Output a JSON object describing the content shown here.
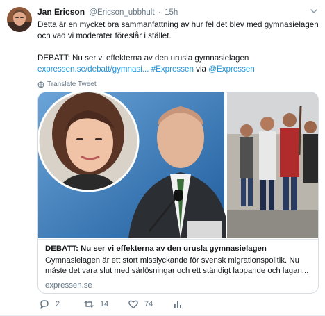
{
  "tweet": {
    "author_name": "Jan Ericson",
    "author_handle": "@Ericson_ubbhult",
    "separator": "·",
    "time": "15h",
    "text_line1": "Detta är en mycket bra sammanfattning av hur fel det blev med gymnasielagen och vad vi moderater föreslår i stället.",
    "text_line2": "DEBATT: Nu ser vi effekterna av den urusla gymnasielagen",
    "link_url": "expressen.se/debatt/gymnasi...",
    "hashtag": "#Expressen",
    "via_word": "via",
    "mention": "@Expressen",
    "translate_label": "Translate Tweet"
  },
  "card": {
    "title": "DEBATT: Nu ser vi effekterna av den urusla gymnasielagen",
    "description": "Gymnasielagen är ett stort misslyckande för svensk migrationspolitik. Nu måste det vara slut med särlösningar och ett ständigt lappande och lagan...",
    "domain": "expressen.se"
  },
  "actions": {
    "replies": "2",
    "retweets": "14",
    "likes": "74"
  },
  "icons": {
    "avatar": "profile-photo",
    "caret": "chevron-down-icon",
    "translate": "globe-icon",
    "reply": "reply-icon",
    "retweet": "retweet-icon",
    "like": "heart-icon",
    "stats": "analytics-icon"
  },
  "colors": {
    "link": "#1b95e0",
    "muted": "#657786",
    "text": "#14171a",
    "border": "#d6dde3"
  }
}
